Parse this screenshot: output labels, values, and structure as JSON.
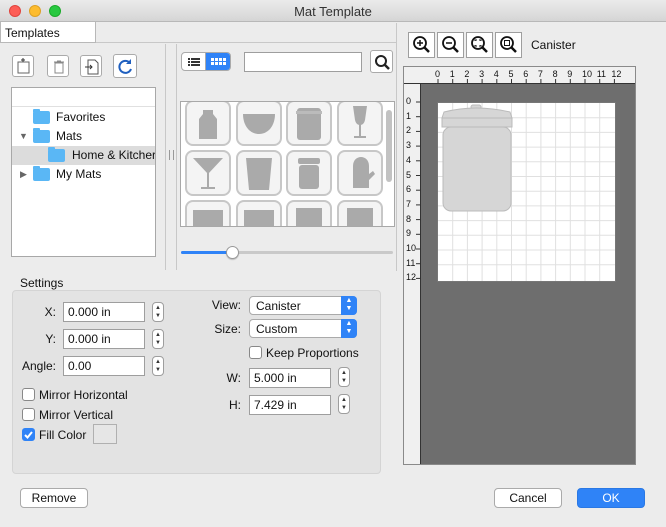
{
  "window": {
    "title": "Mat Template"
  },
  "tabs": {
    "templates": "Templates"
  },
  "tree": [
    {
      "label": "Favorites"
    },
    {
      "label": "Mats"
    },
    {
      "label": "Home & Kitcher"
    },
    {
      "label": "My Mats"
    }
  ],
  "search": {
    "value": "",
    "placeholder": ""
  },
  "view_modes": {
    "list": "list-view-icon",
    "grid": "grid-view-icon"
  },
  "preview": {
    "template_name": "Canister",
    "ruler_numbers": [
      "0",
      "1",
      "2",
      "3",
      "4",
      "5",
      "6",
      "7",
      "8",
      "9",
      "10",
      "11",
      "12"
    ]
  },
  "grid": {
    "size_slider": 0.25
  },
  "settings": {
    "title": "Settings",
    "x_label": "X:",
    "x_value": "0.000 in",
    "y_label": "Y:",
    "y_value": "0.000 in",
    "angle_label": "Angle:",
    "angle_value": "0.00",
    "mirror_h": "Mirror Horizontal",
    "mirror_v": "Mirror Vertical",
    "fill_color": "Fill Color",
    "view_label": "View:",
    "view_value": "Canister",
    "size_label": "Size:",
    "size_value": "Custom",
    "keep_proportions": "Keep Proportions",
    "w_label": "W:",
    "w_value": "5.000 in",
    "h_label": "H:",
    "h_value": "7.429 in"
  },
  "buttons": {
    "remove": "Remove",
    "cancel": "Cancel",
    "ok": "OK"
  },
  "colors": {
    "accent": "#2f83f7",
    "selection": "#dcdcdc",
    "mat_dark": "#6e6e6e"
  }
}
